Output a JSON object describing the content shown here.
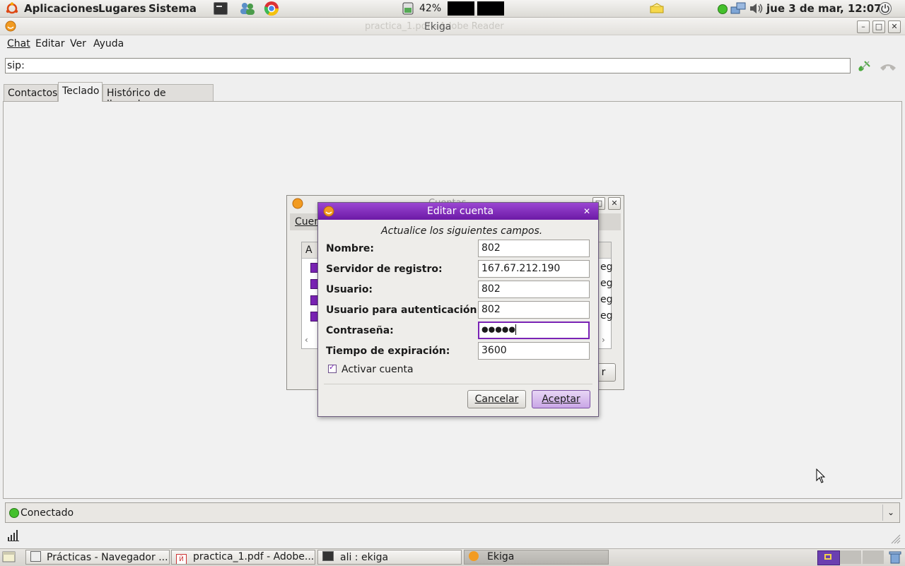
{
  "top_panel": {
    "menus": [
      "Aplicaciones",
      "Lugares",
      "Sistema"
    ],
    "battery": "42%",
    "datetime": "jue  3 de mar, 12:07"
  },
  "window": {
    "title": "Ekiga",
    "behind_title": "practica_1.pdf - Adobe Reader"
  },
  "menubar": [
    "Chat",
    "Editar",
    "Ver",
    "Ayuda"
  ],
  "sip": {
    "value": "sip:"
  },
  "tabs": [
    "Contactos",
    "Teclado",
    "Histórico de llamadas"
  ],
  "accounts_dialog": {
    "title": "Cuentas",
    "menu": "Cuen",
    "column": "A",
    "row_suffix": "eg",
    "button_fragment": "r"
  },
  "edit_dialog": {
    "title": "Editar cuenta",
    "instruction": "Actualice los siguientes campos.",
    "fields": [
      {
        "label": "Nombre:",
        "value": "802"
      },
      {
        "label": "Servidor de registro:",
        "value": "167.67.212.190"
      },
      {
        "label": "Usuario:",
        "value": "802"
      },
      {
        "label": "Usuario para autenticación:",
        "value": "802"
      },
      {
        "label": "Contraseña:",
        "value": "●●●●●"
      },
      {
        "label": "Tiempo de expiración:",
        "value": "3600"
      }
    ],
    "checkbox_label": "Activar cuenta",
    "cancel": "Cancelar",
    "accept": "Aceptar"
  },
  "status": {
    "text": "Conectado",
    "color": "#3fbf2a"
  },
  "taskbar": [
    "Prácticas - Navegador ...",
    "practica_1.pdf - Adobe...",
    "ali : ekiga",
    "Ekiga"
  ],
  "colors": {
    "accent": "#7a23b5",
    "panel": "#dcdad5"
  }
}
